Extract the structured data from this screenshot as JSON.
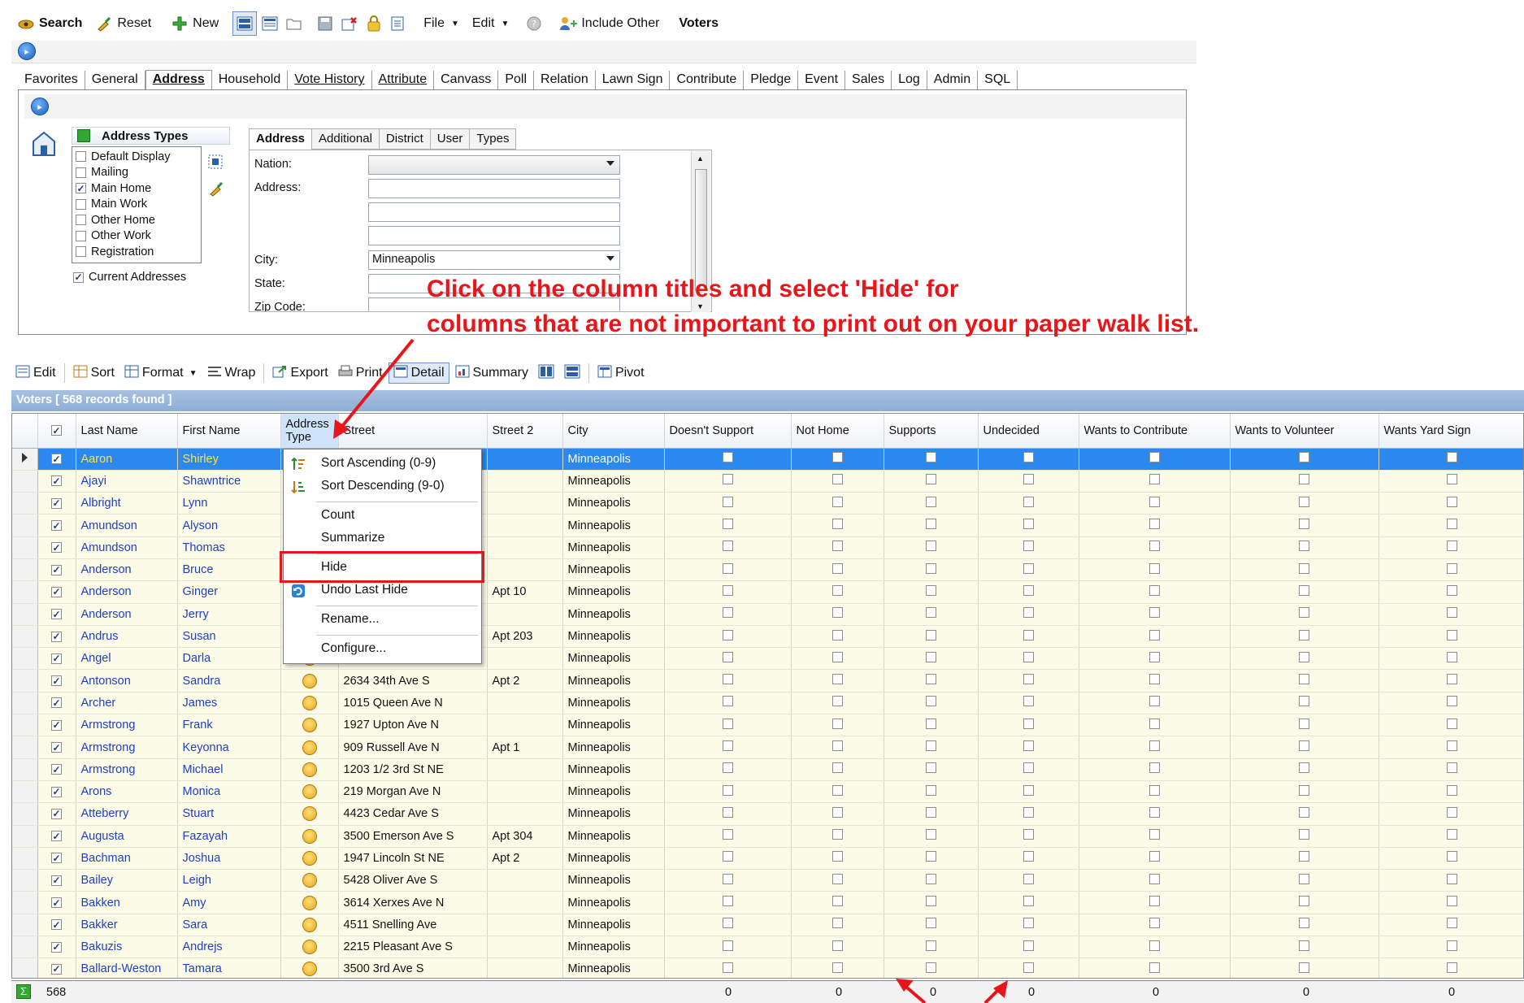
{
  "toolbar": {
    "items": [
      "Search",
      "Reset",
      "New",
      "File",
      "Edit",
      "Include Other",
      "Voters"
    ]
  },
  "tabs": [
    "Favorites",
    "General",
    "Address",
    "Household",
    "Vote History",
    "Attribute",
    "Canvass",
    "Poll",
    "Relation",
    "Lawn Sign",
    "Contribute",
    "Pledge",
    "Event",
    "Sales",
    "Log",
    "Admin",
    "SQL"
  ],
  "address_types": {
    "title": "Address Types",
    "items": [
      {
        "label": "Default Display",
        "checked": false
      },
      {
        "label": "Mailing",
        "checked": false
      },
      {
        "label": "Main Home",
        "checked": true
      },
      {
        "label": "Main Work",
        "checked": false
      },
      {
        "label": "Other Home",
        "checked": false
      },
      {
        "label": "Other Work",
        "checked": false
      },
      {
        "label": "Registration",
        "checked": false
      }
    ],
    "current_label": "Current Addresses"
  },
  "subtabs": [
    "Address",
    "Additional",
    "District",
    "User",
    "Types"
  ],
  "form": {
    "nation_label": "Nation:",
    "address_label": "Address:",
    "city_label": "City:",
    "city_value": "Minneapolis",
    "state_label": "State:",
    "zip_label": "Zip Code:"
  },
  "annotation": {
    "line1": "Click on the column titles and select 'Hide' for",
    "line2": "columns that are not important to print out on your paper walk list."
  },
  "grid_toolbar": [
    "Edit",
    "Sort",
    "Format",
    "Wrap",
    "Export",
    "Print",
    "Detail",
    "Summary",
    "Pivot"
  ],
  "records_label": "Voters [ 568 records found ]",
  "columns": [
    "Last Name",
    "First Name",
    "Address Type",
    "Street",
    "Street 2",
    "City",
    "Doesn't Support",
    "Not Home",
    "Supports",
    "Undecided",
    "Wants to  Contribute",
    "Wants to  Volunteer",
    "Wants  Yard Sign"
  ],
  "rows": [
    [
      "Aaron",
      "Shirley",
      "",
      "",
      "Minneapolis"
    ],
    [
      "Ajayi",
      "Shawntrice",
      "",
      "",
      "Minneapolis"
    ],
    [
      "Albright",
      "Lynn",
      "",
      "",
      "Minneapolis"
    ],
    [
      "Amundson",
      "Alyson",
      "",
      "",
      "Minneapolis"
    ],
    [
      "Amundson",
      "Thomas",
      "",
      "",
      "Minneapolis"
    ],
    [
      "Anderson",
      "Bruce",
      "",
      "",
      "Minneapolis"
    ],
    [
      "Anderson",
      "Ginger",
      "",
      "Apt 10",
      "Minneapolis"
    ],
    [
      "Anderson",
      "Jerry",
      "",
      "",
      "Minneapolis"
    ],
    [
      "Andrus",
      "Susan",
      "",
      "Apt 203",
      "Minneapolis"
    ],
    [
      "Angel",
      "Darla",
      "",
      "",
      "Minneapolis"
    ],
    [
      "Antonson",
      "Sandra",
      "2634 34th Ave S",
      "Apt 2",
      "Minneapolis"
    ],
    [
      "Archer",
      "James",
      "1015 Queen Ave N",
      "",
      "Minneapolis"
    ],
    [
      "Armstrong",
      "Frank",
      "1927 Upton Ave N",
      "",
      "Minneapolis"
    ],
    [
      "Armstrong",
      "Keyonna",
      "909 Russell Ave N",
      "Apt 1",
      "Minneapolis"
    ],
    [
      "Armstrong",
      "Michael",
      "1203 1/2 3rd St NE",
      "",
      "Minneapolis"
    ],
    [
      "Arons",
      "Monica",
      "219 Morgan Ave N",
      "",
      "Minneapolis"
    ],
    [
      "Atteberry",
      "Stuart",
      "4423 Cedar Ave S",
      "",
      "Minneapolis"
    ],
    [
      "Augusta",
      "Fazayah",
      "3500 Emerson Ave S",
      "Apt 304",
      "Minneapolis"
    ],
    [
      "Bachman",
      "Joshua",
      "1947 Lincoln St NE",
      "Apt 2",
      "Minneapolis"
    ],
    [
      "Bailey",
      "Leigh",
      "5428 Oliver Ave S",
      "",
      "Minneapolis"
    ],
    [
      "Bakken",
      "Amy",
      "3614 Xerxes Ave N",
      "",
      "Minneapolis"
    ],
    [
      "Bakker",
      "Sara",
      "4511 Snelling Ave",
      "",
      "Minneapolis"
    ],
    [
      "Bakuzis",
      "Andrejs",
      "2215 Pleasant Ave S",
      "",
      "Minneapolis"
    ],
    [
      "Ballard-Weston",
      "Tamara",
      "3500 3rd Ave S",
      "",
      "Minneapolis"
    ]
  ],
  "footer": {
    "count": "568",
    "totals": [
      "0",
      "0",
      "0",
      "0",
      "0",
      "0",
      "0"
    ]
  },
  "context_menu": {
    "sort_asc": "Sort Ascending (0-9)",
    "sort_desc": "Sort Descending (9-0)",
    "count": "Count",
    "summarize": "Summarize",
    "hide": "Hide",
    "undo_hide": "Undo Last Hide",
    "rename": "Rename...",
    "configure": "Configure..."
  },
  "colors": {
    "annotation": "#e8161b",
    "selected_row": "#2b88ef",
    "row_bg": "#fbfbe8",
    "link_text": "#1f3fbf"
  }
}
